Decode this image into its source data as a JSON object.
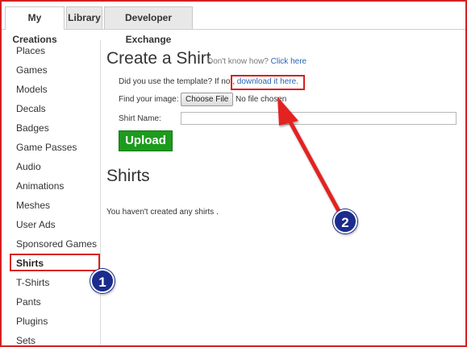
{
  "tabs": [
    {
      "label": "My Creations",
      "active": true
    },
    {
      "label": "Library",
      "active": false
    },
    {
      "label": "Developer Exchange",
      "active": false
    }
  ],
  "sidebar": {
    "items": [
      {
        "label": "Places"
      },
      {
        "label": "Games"
      },
      {
        "label": "Models"
      },
      {
        "label": "Decals"
      },
      {
        "label": "Badges"
      },
      {
        "label": "Game Passes"
      },
      {
        "label": "Audio"
      },
      {
        "label": "Animations"
      },
      {
        "label": "Meshes"
      },
      {
        "label": "User Ads"
      },
      {
        "label": "Sponsored Games"
      },
      {
        "label": "Shirts"
      },
      {
        "label": "T-Shirts"
      },
      {
        "label": "Pants"
      },
      {
        "label": "Plugins"
      },
      {
        "label": "Sets"
      }
    ],
    "active_item": "Shirts"
  },
  "create": {
    "title": "Create a Shirt",
    "hint_text": "Don't know how?",
    "hint_link": "Click here",
    "template_text": "Did you use the template? If not,",
    "template_link": "download it here.",
    "image_label": "Find your image:",
    "choose_file_label": "Choose File",
    "no_file_text": "No file chosen",
    "name_label": "Shirt Name:",
    "name_value": "",
    "upload_label": "Upload"
  },
  "shirts": {
    "title": "Shirts",
    "empty_text": "You haven't created any shirts ."
  },
  "annotations": {
    "badge1": "1",
    "badge2": "2",
    "color": "#d81f1f",
    "badge_color": "#1b2c8c"
  }
}
